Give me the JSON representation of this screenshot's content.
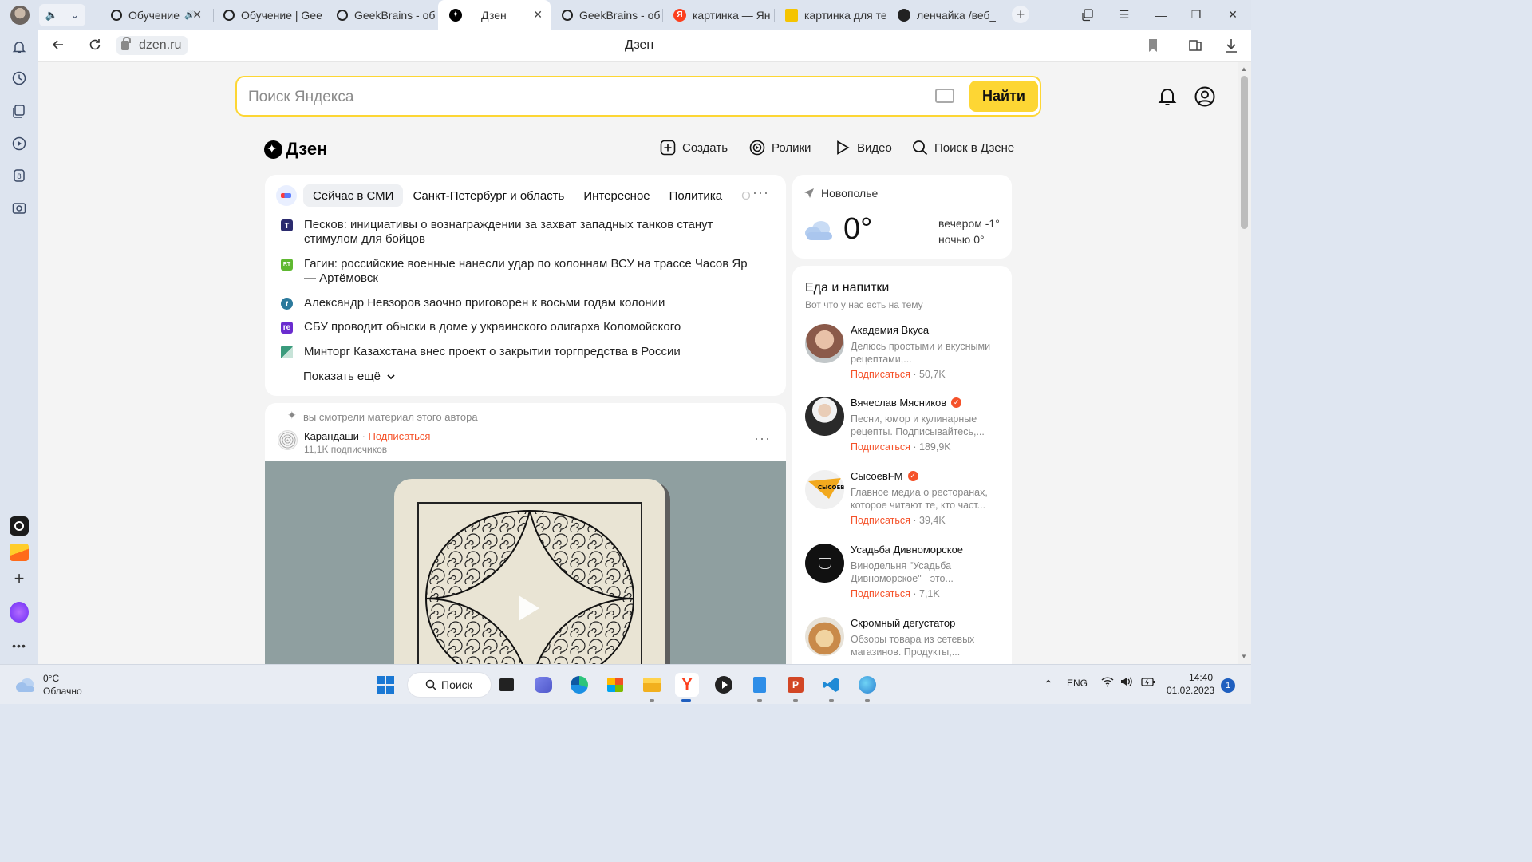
{
  "browser": {
    "tabs": [
      {
        "label": "Обучение",
        "favicon": "geekbrains-icon",
        "audio": true
      },
      {
        "label": "Обучение | Gee",
        "favicon": "geekbrains-icon"
      },
      {
        "label": "GeekBrains - об",
        "favicon": "geekbrains-icon"
      },
      {
        "label": "Дзен",
        "favicon": "dzen-icon",
        "active": true
      },
      {
        "label": "GeekBrains - об",
        "favicon": "geekbrains-icon"
      },
      {
        "label": "картинка — Ян",
        "favicon": "yandex-icon"
      },
      {
        "label": "картинка для те",
        "favicon": "image-icon"
      },
      {
        "label": "ленчайка /веб_",
        "favicon": "github-icon"
      }
    ],
    "close_glyph": "✕",
    "url": "dzen.ru",
    "page_title": "Дзен"
  },
  "search": {
    "placeholder": "Поиск Яндекса",
    "button_label": "Найти"
  },
  "dzen": {
    "logo_text": "Дзен",
    "nav": [
      {
        "label": "Создать"
      },
      {
        "label": "Ролики"
      },
      {
        "label": "Видео"
      },
      {
        "label": "Поиск в Дзене"
      }
    ]
  },
  "news": {
    "tabs": [
      "Сейчас в СМИ",
      "Санкт-Петербург и область",
      "Интересное",
      "Политика",
      "О"
    ],
    "items": [
      {
        "source_badge": "T",
        "source_color": "#2b2b6e",
        "text": "Песков: инициативы о вознаграждении за захват западных танков станут стимулом для бойцов"
      },
      {
        "source_badge": "RT",
        "source_color": "#5fb831",
        "text": "Гагин: российские военные нанесли удар по колоннам ВСУ на трассе Часов Яр — Артёмовск"
      },
      {
        "source_badge": "f",
        "source_color": "#2c7a9c",
        "text": "Александр Невзоров заочно приговорен к восьми годам колонии"
      },
      {
        "source_badge": "re",
        "source_color": "#6a2ccf",
        "text": "СБУ проводит обыски в доме у украинского олигарха Коломойского"
      },
      {
        "source_badge": "",
        "source_color": "#3a9b7c",
        "text": "Минторг Казахстана внес проект о закрытии торгпредства в России"
      }
    ],
    "show_more": "Показать ещё"
  },
  "post": {
    "hint": "вы смотрели материал этого автора",
    "author": "Карандаши",
    "separator": " · ",
    "subscribe": "Подписаться",
    "followers": "11,1K подписчиков"
  },
  "weather": {
    "city": "Новополье",
    "temp": "0°",
    "evening": "вечером -1°",
    "night": "ночью 0°"
  },
  "food": {
    "title": "Еда и напитки",
    "subtitle": "Вот что у нас есть на тему",
    "channels": [
      {
        "name": "Академия Вкуса",
        "verified": false,
        "desc": "Делюсь простыми и вкусными рецептами,...",
        "subscribe": "Подписаться",
        "count": " · 50,7K",
        "avatar_color": "#8b5a4a"
      },
      {
        "name": "Вячеслав Мясников",
        "verified": true,
        "desc": "Песни, юмор и кулинарные рецепты. Подписывайтесь,...",
        "subscribe": "Подписаться",
        "count": " · 189,9K",
        "avatar_color": "#2a2a2a"
      },
      {
        "name": "СысоевFM",
        "verified": true,
        "desc": "Главное медиа о ресторанах, которое читают те, кто част...",
        "subscribe": "Подписаться",
        "count": " · 39,4K",
        "avatar_color": "#f2a91e"
      },
      {
        "name": "Усадьба Дивноморское",
        "verified": false,
        "desc": "Винодельня \"Усадьба Дивноморское\" - это...",
        "subscribe": "Подписаться",
        "count": " · 7,1K",
        "avatar_color": "#111111"
      },
      {
        "name": "Скромный дегустатор",
        "verified": false,
        "desc": "Обзоры товара из сетевых магазинов. Продукты,...",
        "subscribe": "Подписаться",
        "count": "",
        "avatar_color": "#c98a4a"
      }
    ]
  },
  "taskbar": {
    "weather_temp": "0°C",
    "weather_desc": "Облачно",
    "search_label": "Поиск",
    "lang": "ENG",
    "time": "14:40",
    "date": "01.02.2023",
    "notifications": "1"
  },
  "colors": {
    "accent_yellow": "#fdd634",
    "subscribe_orange": "#f5522a",
    "yandex_red": "#fc3f1d"
  }
}
